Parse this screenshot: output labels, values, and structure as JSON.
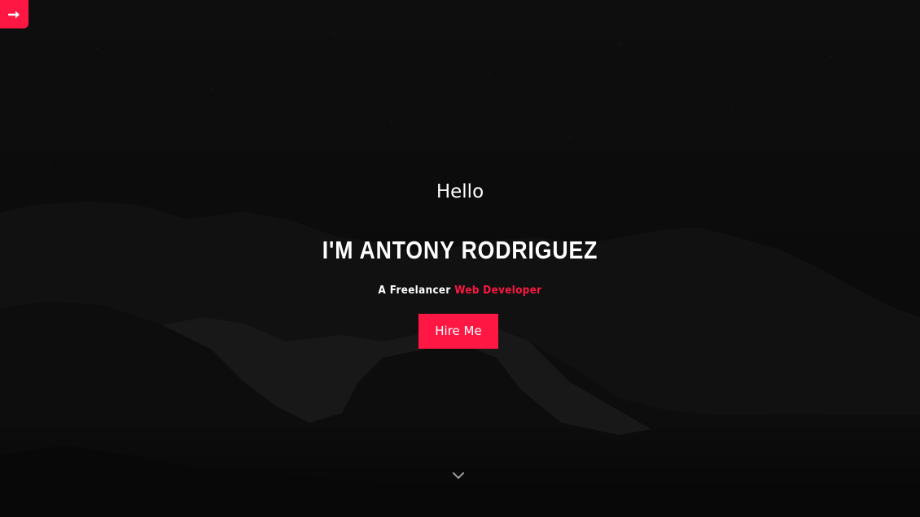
{
  "colors": {
    "accent": "#ff1744",
    "text": "#ffffff",
    "background": "#0b0b0b"
  },
  "nav": {
    "toggle_icon": "arrow-right-icon"
  },
  "hero": {
    "greeting": "Hello",
    "name": "I'M ANTONY RODRIGUEZ",
    "tagline_prefix": "A Freelancer",
    "tagline_highlight": "Web Developer",
    "cta_label": "Hire Me",
    "scroll_icon": "chevron-down-icon"
  }
}
